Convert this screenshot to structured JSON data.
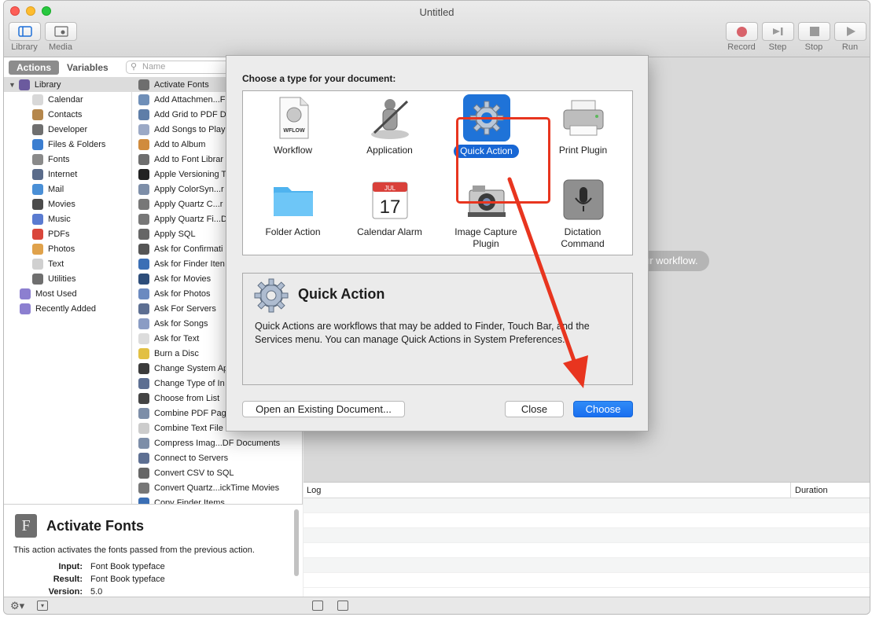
{
  "window": {
    "title": "Untitled"
  },
  "toolbar": {
    "library_label": "Library",
    "media_label": "Media",
    "record_label": "Record",
    "step_label": "Step",
    "stop_label": "Stop",
    "run_label": "Run"
  },
  "left": {
    "tab_actions": "Actions",
    "tab_variables": "Variables",
    "search_placeholder": "Name",
    "library": {
      "root": "Library",
      "items": [
        "Calendar",
        "Contacts",
        "Developer",
        "Files & Folders",
        "Fonts",
        "Internet",
        "Mail",
        "Movies",
        "Music",
        "PDFs",
        "Photos",
        "Text",
        "Utilities"
      ],
      "extra": [
        "Most Used",
        "Recently Added"
      ]
    },
    "actions": [
      "Activate Fonts",
      "Add Attachmen...F",
      "Add Grid to PDF D",
      "Add Songs to Play",
      "Add to Album",
      "Add to Font Librar",
      "Apple Versioning T",
      "Apply ColorSyn...r",
      "Apply Quartz C...r",
      "Apply Quartz Fi...D",
      "Apply SQL",
      "Ask for Confirmati",
      "Ask for Finder Iten",
      "Ask for Movies",
      "Ask for Photos",
      "Ask For Servers",
      "Ask for Songs",
      "Ask for Text",
      "Burn a Disc",
      "Change System Ap",
      "Change Type of In",
      "Choose from List",
      "Combine PDF Pag",
      "Combine Text File",
      "Compress Imag...DF Documents",
      "Connect to Servers",
      "Convert CSV to SQL",
      "Convert Quartz...ickTime Movies",
      "Copy Finder Items"
    ]
  },
  "description": {
    "title": "Activate Fonts",
    "text": "This action activates the fonts passed from the previous action.",
    "input_label": "Input:",
    "input_value": "Font Book typeface",
    "result_label": "Result:",
    "result_value": "Font Book typeface",
    "version_label": "Version:",
    "version_value": "5.0"
  },
  "workflow": {
    "hint": "ur workflow."
  },
  "log": {
    "col_log": "Log",
    "col_duration": "Duration"
  },
  "dialog": {
    "prompt": "Choose a type for your document:",
    "types": [
      {
        "label": "Workflow",
        "icon": "workflow-icon"
      },
      {
        "label": "Application",
        "icon": "application-icon"
      },
      {
        "label": "Quick Action",
        "icon": "gear-icon",
        "selected": true
      },
      {
        "label": "Print Plugin",
        "icon": "printer-icon"
      },
      {
        "label": "Folder Action",
        "icon": "folder-icon"
      },
      {
        "label": "Calendar Alarm",
        "icon": "calendar-icon"
      },
      {
        "label": "Image Capture Plugin",
        "icon": "camera-icon"
      },
      {
        "label": "Dictation Command",
        "icon": "microphone-icon"
      }
    ],
    "calendar_month": "JUL",
    "calendar_day": "17",
    "workflow_icon_text": "WFLOW",
    "info_title": "Quick Action",
    "info_text": "Quick Actions are workflows that may be added to Finder, Touch Bar, and the Services menu. You can manage Quick Actions in System Preferences.",
    "open_existing": "Open an Existing Document...",
    "close": "Close",
    "choose": "Choose"
  },
  "colors": {
    "accent": "#1766d4",
    "annotation": "#e8351f"
  }
}
